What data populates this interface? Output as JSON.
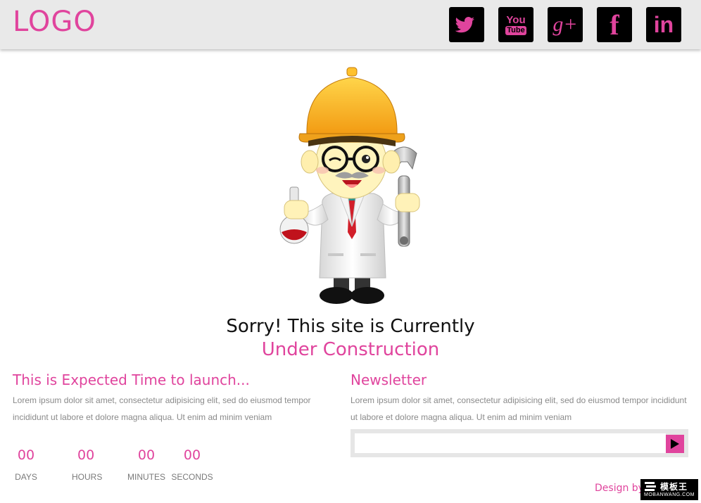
{
  "header": {
    "logo": "LOGO",
    "social": [
      {
        "name": "twitter-icon",
        "label": ""
      },
      {
        "name": "youtube-icon",
        "label": [
          "You",
          "Tube"
        ]
      },
      {
        "name": "google-plus-icon",
        "label": "g+"
      },
      {
        "name": "facebook-icon",
        "label": "f"
      },
      {
        "name": "linkedin-icon",
        "label": "in"
      }
    ]
  },
  "hero": {
    "line1": "Sorry! This site is Currently",
    "line2": "Under Construction"
  },
  "launch": {
    "title": "This is Expected Time to launch...",
    "text": " Lorem ipsum dolor sit amet, consectetur adipisicing elit, sed do eiusmod tempor incididunt ut labore et dolore magna aliqua. Ut enim ad minim veniam",
    "countdown": [
      {
        "value": "00",
        "label": "DAYS"
      },
      {
        "value": "00",
        "label": "HOURS"
      },
      {
        "value": "00",
        "label": "MINUTES"
      },
      {
        "value": "00",
        "label": "SECONDS"
      }
    ]
  },
  "newsletter": {
    "title": "Newsletter",
    "text": "Lorem ipsum dolor sit amet, consectetur adipisicing elit, sed do eiusmod tempor incididunt ut labore et dolore magna aliqua. Ut enim ad minim veniam",
    "input_value": "",
    "placeholder": ""
  },
  "footer": {
    "design_by": "Design by",
    "brand_main": "模板王",
    "brand_sub": "MOBANWANG.COM"
  },
  "colors": {
    "accent": "#e0449d",
    "header_bg": "#e9e9e9",
    "icon_bg": "#000000"
  }
}
